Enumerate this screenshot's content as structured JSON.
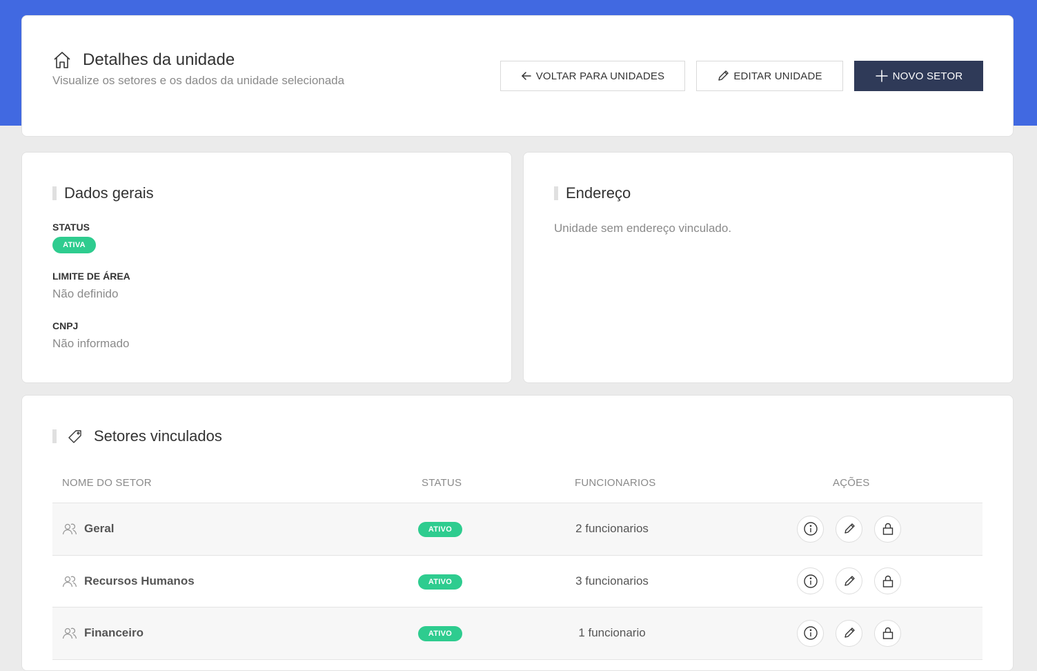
{
  "header": {
    "title": "Detalhes da unidade",
    "subtitle": "Visualize os setores e os dados da unidade selecionada",
    "buttons": {
      "back": "VOLTAR PARA UNIDADES",
      "edit": "EDITAR UNIDADE",
      "new": "NOVO SETOR"
    }
  },
  "general": {
    "title": "Dados gerais",
    "status_label": "STATUS",
    "status_value": "ATIVA",
    "area_label": "LIMITE DE ÁREA",
    "area_value": "Não definido",
    "cnpj_label": "CNPJ",
    "cnpj_value": "Não informado"
  },
  "address": {
    "title": "Endereço",
    "empty_text": "Unidade sem endereço vinculado."
  },
  "sectors": {
    "title": "Setores vinculados",
    "columns": [
      "NOME DO SETOR",
      "STATUS",
      "FUNCIONARIOS",
      "AÇÕES"
    ],
    "rows": [
      {
        "name": "Geral",
        "status": "ATIVO",
        "employees": "2 funcionarios"
      },
      {
        "name": "Recursos Humanos",
        "status": "ATIVO",
        "employees": "3 funcionarios"
      },
      {
        "name": "Financeiro",
        "status": "ATIVO",
        "employees": "1 funcionario"
      }
    ]
  },
  "colors": {
    "accent_band": "#4169e1",
    "primary_button": "#2f3a58",
    "status_green": "#2ecc8f"
  },
  "icons": [
    "home-icon",
    "arrow-left-icon",
    "pencil-icon",
    "plus-icon",
    "tag-icon",
    "users-icon",
    "info-icon",
    "lock-icon"
  ]
}
